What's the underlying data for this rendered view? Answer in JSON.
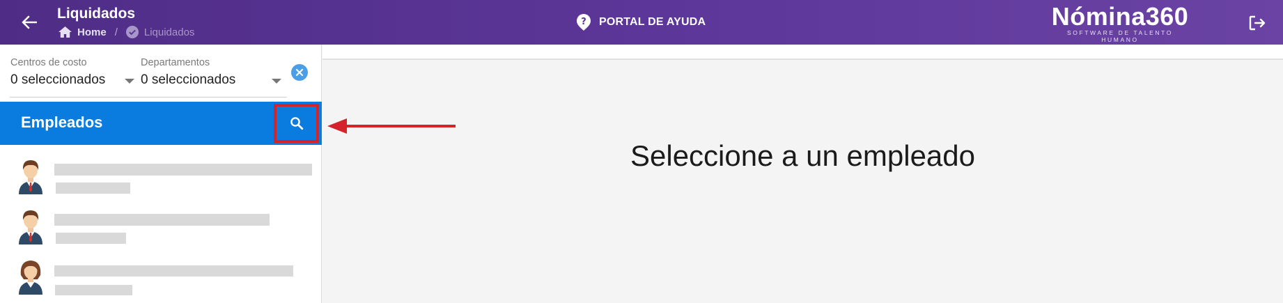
{
  "header": {
    "title": "Liquidados",
    "breadcrumb": {
      "home": "Home",
      "current": "Liquidados"
    },
    "help_label": "PORTAL DE AYUDA",
    "brand_name": "Nómina360",
    "brand_tagline": "SOFTWARE DE TALENTO HUMANO",
    "icons": {
      "back": "arrow-left-icon",
      "home": "home-icon",
      "current": "check-circle-icon",
      "help": "help-circle-icon",
      "logout": "logout-icon"
    }
  },
  "filters": {
    "cost_centers": {
      "label": "Centros de costo",
      "value": "0 seleccionados"
    },
    "departments": {
      "label": "Departamentos",
      "value": "0 seleccionados"
    },
    "clear_icon": "close-circle-icon"
  },
  "employees": {
    "title": "Empleados",
    "search_icon": "search-icon",
    "items": [
      {
        "avatar": "male-avatar-icon"
      },
      {
        "avatar": "male-avatar-icon"
      },
      {
        "avatar": "female-avatar-icon"
      }
    ]
  },
  "main": {
    "message": "Seleccione a un empleado"
  },
  "colors": {
    "header_bg": "#5a3596",
    "employees_header_bg": "#0a7ce0",
    "highlight_border": "#d4232a",
    "skeleton": "#d9d9d9"
  }
}
